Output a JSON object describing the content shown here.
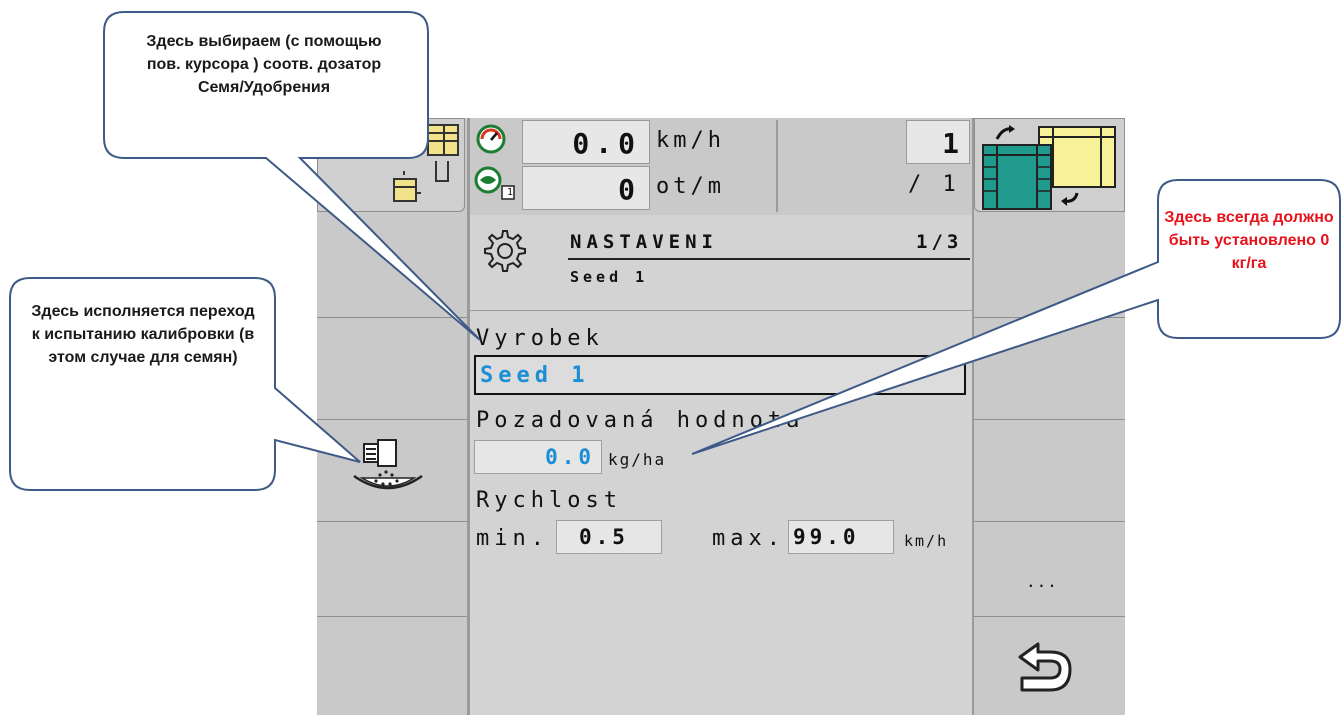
{
  "status_bar": {
    "speed_value": "0.0",
    "speed_unit": "km/h",
    "rpm_value": "0",
    "rpm_unit": "ot/m",
    "rpm_sub_index": "1",
    "section_number": "1",
    "section_total": "/ 1"
  },
  "panel": {
    "title": "NASTAVENI",
    "page_indicator": "1/3",
    "subtitle": "Seed 1",
    "product_label": "Vyrobek",
    "product_value": "Seed 1",
    "rate_label": "Pozadovaná hodnota",
    "rate_value": "0.0",
    "rate_unit": "kg/ha",
    "speed_label": "Rychlost",
    "min_label": "min.",
    "min_value": "0.5",
    "max_label": "max.",
    "max_value": "99.0",
    "speed_unit": "km/h"
  },
  "softkeys": {
    "more_label": "..."
  },
  "callouts": {
    "top": "Здесь выбираем (с помощью пов. курсора ) соотв. дозатор Семя/Удобрения",
    "left": "Здесь исполняется переход к испытанию калибровки (в этом случае для семян)",
    "right": "Здесь всегда должно быть установлено 0 кг/га"
  },
  "colors": {
    "accent_value": "#1b8fd6",
    "callout_red": "#e8121b",
    "callout_border": "#3e5a86"
  },
  "icons": [
    "speedometer-icon",
    "fan-rpm-icon",
    "settings-gear-icon",
    "calibration-icon",
    "back-arrow-icon",
    "seed-hopper-icon",
    "tank-switch-icon"
  ]
}
